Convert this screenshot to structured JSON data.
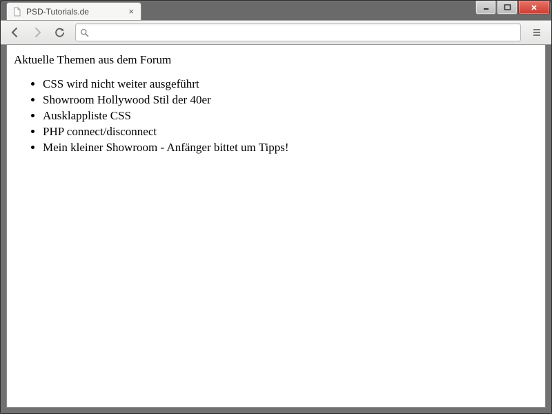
{
  "window": {
    "tab_title": "PSD-Tutorials.de"
  },
  "omnibox": {
    "value": ""
  },
  "page": {
    "heading": "Aktuelle Themen aus dem Forum",
    "items": [
      "CSS wird nicht weiter ausgeführt",
      "Showroom Hollywood Stil der 40er",
      "Ausklappliste CSS",
      "PHP connect/disconnect",
      "Mein kleiner Showroom - Anfänger bittet um Tipps!"
    ]
  }
}
